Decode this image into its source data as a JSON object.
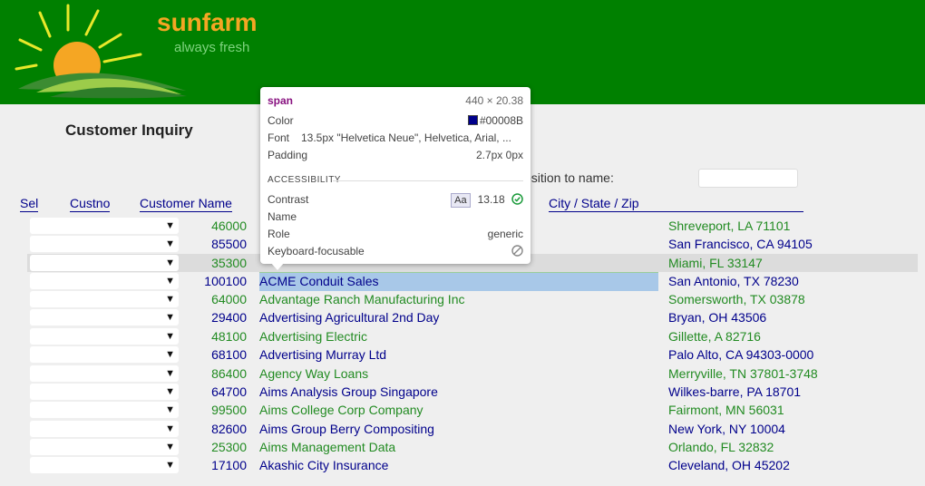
{
  "brand": {
    "name": "sunfarm",
    "tagline": "always fresh"
  },
  "page": {
    "title": "Customer Inquiry",
    "position_label": "osition to name:"
  },
  "columns": {
    "sel": "Sel",
    "custno": "Custno",
    "customer_name": "Customer Name",
    "city": "City / State / Zip"
  },
  "rows": [
    {
      "custno": "46000",
      "name": "",
      "city": "Shreveport, LA 71101",
      "color": "green"
    },
    {
      "custno": "85500",
      "name": "",
      "city": "San Francisco, CA 94105",
      "color": "blue"
    },
    {
      "custno": "35300",
      "name": "",
      "city": "Miami, FL 33147",
      "color": "green"
    },
    {
      "custno": "100100",
      "name": "ACME Conduit Sales",
      "city": "San Antonio, TX 78230",
      "color": "blue"
    },
    {
      "custno": "64000",
      "name": "Advantage Ranch Manufacturing Inc",
      "city": "Somersworth, TX 03878",
      "color": "green"
    },
    {
      "custno": "29400",
      "name": "Advertising Agricultural 2nd Day",
      "city": "Bryan, OH 43506",
      "color": "blue"
    },
    {
      "custno": "48100",
      "name": "Advertising Electric",
      "city": "Gillette, A 82716",
      "color": "green"
    },
    {
      "custno": "68100",
      "name": "Advertising Murray Ltd",
      "city": "Palo Alto, CA 94303-0000",
      "color": "blue"
    },
    {
      "custno": "86400",
      "name": "Agency Way Loans",
      "city": "Merryville, TN 37801-3748",
      "color": "green"
    },
    {
      "custno": "64700",
      "name": "Aims Analysis Group Singapore",
      "city": "Wilkes-barre, PA 18701",
      "color": "blue"
    },
    {
      "custno": "99500",
      "name": "Aims College Corp Company",
      "city": "Fairmont, MN 56031",
      "color": "green"
    },
    {
      "custno": "82600",
      "name": "Aims Group Berry Compositing",
      "city": "New York, NY 10004",
      "color": "blue"
    },
    {
      "custno": "25300",
      "name": "Aims Management Data",
      "city": "Orlando, FL 32832",
      "color": "green"
    },
    {
      "custno": "17100",
      "name": "Akashic City Insurance",
      "city": "Cleveland, OH 45202",
      "color": "blue"
    }
  ],
  "tooltip": {
    "tag": "span",
    "size": "440 × 20.38",
    "color_label": "Color",
    "color_value": "#00008B",
    "font_label": "Font",
    "font_value": "13.5px \"Helvetica Neue\", Helvetica, Arial, ...",
    "padding_label": "Padding",
    "padding_value": "2.7px 0px",
    "accessibility_heading": "ACCESSIBILITY",
    "contrast_label": "Contrast",
    "contrast_badge": "Aa",
    "contrast_value": "13.18",
    "name_label": "Name",
    "role_label": "Role",
    "role_value": "generic",
    "keyboard_label": "Keyboard-focusable"
  },
  "colors": {
    "header_green": "#008000",
    "brand_orange": "#f5a623",
    "link_blue": "#00008b",
    "row_green": "#228b22"
  }
}
